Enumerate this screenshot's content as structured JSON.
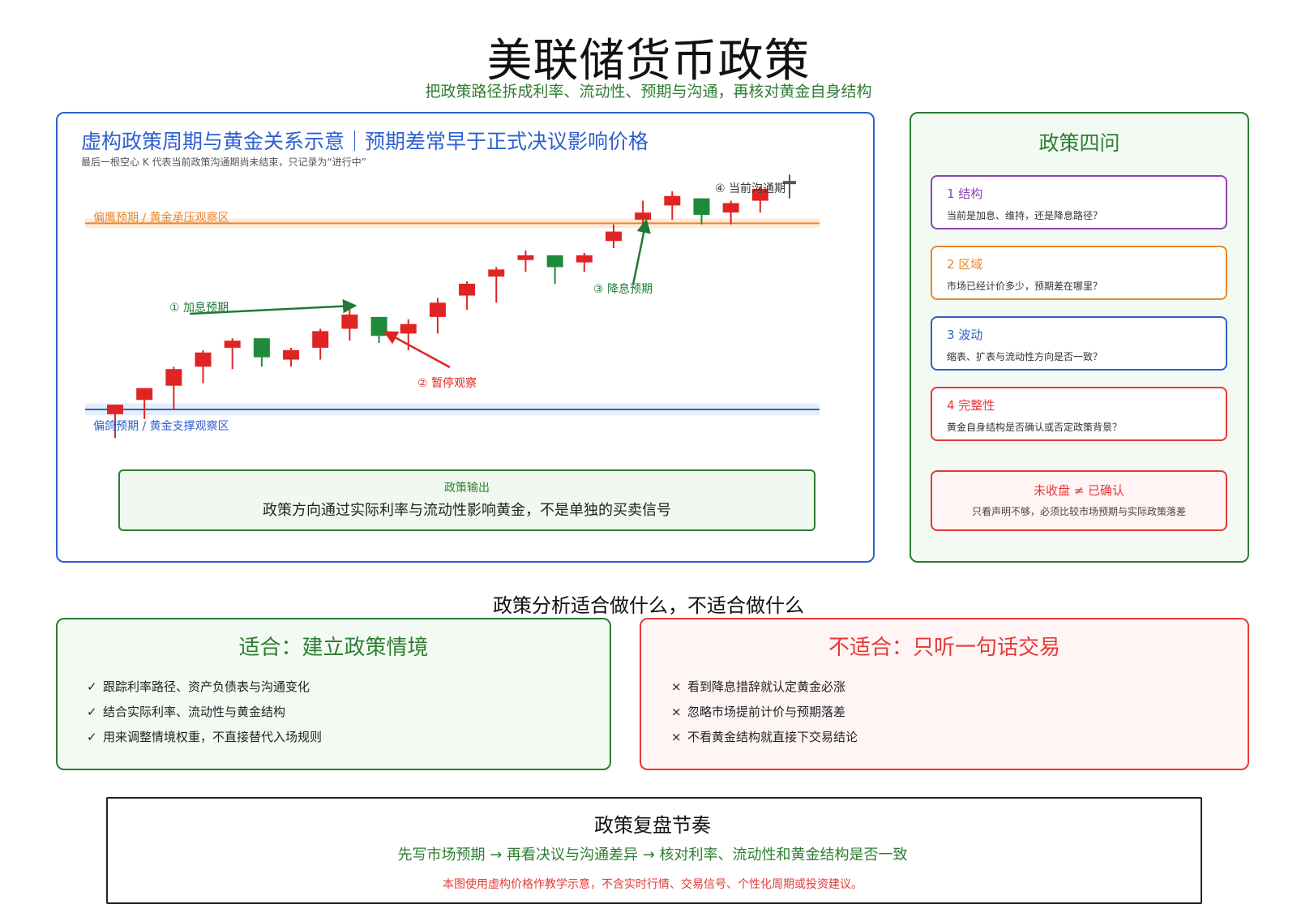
{
  "header": {
    "title": "美联储货币政策",
    "subtitle": "把政策路径拆成利率、流动性、预期与沟通，再核对黄金自身结构"
  },
  "chart_panel": {
    "title": "虚构政策周期与黄金关系示意｜预期差常早于正式决议影响价格",
    "note": "最后一根空心 K 代表当前政策沟通期尚未结束，只记录为“进行中”",
    "upper_zone_label": "偏鹰预期 / 黄金承压观察区",
    "lower_zone_label": "偏鸽预期 / 黄金支撑观察区",
    "annotations": [
      "① 加息预期",
      "② 暂停观察",
      "③ 降息预期",
      "④ 当前沟通期"
    ],
    "output_label": "政策输出",
    "output_text": "政策方向通过实际利率与流动性影响黄金，不是单独的买卖信号"
  },
  "chart_data": {
    "type": "candlestick",
    "note": "fictional illustrative price path",
    "colors": {
      "up": "#e02424",
      "down": "#1e8a3a",
      "open_candle": "#555555",
      "upper_zone": "#e8862d",
      "lower_zone": "#2f5fd0"
    },
    "upper_zone": {
      "center": 86.5,
      "low": 84.5,
      "high": 88.5
    },
    "lower_zone": {
      "center": 8,
      "low": 5.5,
      "high": 10.5
    },
    "ylim": [
      -5,
      102
    ],
    "candles": [
      {
        "o": 6,
        "h": 10,
        "l": -4,
        "c": 10
      },
      {
        "o": 12,
        "h": 17,
        "l": 4,
        "c": 17
      },
      {
        "o": 18,
        "h": 26,
        "l": 8,
        "c": 25
      },
      {
        "o": 26,
        "h": 33,
        "l": 19,
        "c": 32
      },
      {
        "o": 34,
        "h": 38,
        "l": 25,
        "c": 37
      },
      {
        "o": 38,
        "h": 38,
        "l": 26,
        "c": 30
      },
      {
        "o": 29,
        "h": 34,
        "l": 26,
        "c": 33
      },
      {
        "o": 34,
        "h": 42,
        "l": 29,
        "c": 41
      },
      {
        "o": 42,
        "h": 50,
        "l": 37,
        "c": 48
      },
      {
        "o": 47,
        "h": 47,
        "l": 36,
        "c": 39
      },
      {
        "o": 40,
        "h": 46,
        "l": 33,
        "c": 44
      },
      {
        "o": 47,
        "h": 55,
        "l": 40,
        "c": 53
      },
      {
        "o": 56,
        "h": 62,
        "l": 50,
        "c": 61
      },
      {
        "o": 64,
        "h": 68,
        "l": 53,
        "c": 67
      },
      {
        "o": 71,
        "h": 75,
        "l": 66,
        "c": 73
      },
      {
        "o": 73,
        "h": 73,
        "l": 61,
        "c": 68
      },
      {
        "o": 70,
        "h": 74,
        "l": 66,
        "c": 73
      },
      {
        "o": 79,
        "h": 86,
        "l": 76,
        "c": 83
      },
      {
        "o": 88,
        "h": 96,
        "l": 83,
        "c": 91
      },
      {
        "o": 94,
        "h": 100,
        "l": 88,
        "c": 98
      },
      {
        "o": 97,
        "h": 97,
        "l": 86,
        "c": 90
      },
      {
        "o": 91,
        "h": 96,
        "l": 86,
        "c": 95
      },
      {
        "o": 96,
        "h": 102,
        "l": 91,
        "c": 101
      },
      {
        "o": 104,
        "h": 107,
        "l": 97,
        "c": 104,
        "open": true
      }
    ]
  },
  "questions": {
    "title": "政策四问",
    "items": [
      {
        "head": "1 结构",
        "body": "当前是加息、维持，还是降息路径？",
        "color": "#8e44ad"
      },
      {
        "head": "2 区域",
        "body": "市场已经计价多少，预期差在哪里？",
        "color": "#e8862d"
      },
      {
        "head": "3 波动",
        "body": "缩表、扩表与流动性方向是否一致？",
        "color": "#2f5fd0"
      },
      {
        "head": "4 完整性",
        "body": "黄金自身结构是否确认或否定政策背景？",
        "color": "#e53935"
      }
    ],
    "warning_title": "未收盘 ≠ 已确认",
    "warning_text": "只看声明不够，必须比较市场预期与实际政策落差"
  },
  "usage": {
    "section_title": "政策分析适合做什么，不适合做什么",
    "fit_title": "适合：建立政策情境",
    "fit_mark": "✓",
    "fit_items": [
      "跟踪利率路径、资产负债表与沟通变化",
      "结合实际利率、流动性与黄金结构",
      "用来调整情境权重，不直接替代入场规则"
    ],
    "nofit_title": "不适合：只听一句话交易",
    "nofit_mark": "×",
    "nofit_items": [
      "看到降息措辞就认定黄金必涨",
      "忽略市场提前计价与预期落差",
      "不看黄金结构就直接下交易结论"
    ]
  },
  "rhythm": {
    "title": "政策复盘节奏",
    "flow": "先写市场预期 → 再看决议与沟通差异 → 核对利率、流动性和黄金结构是否一致",
    "disclaimer": "本图使用虚构价格作教学示意，不含实时行情、交易信号、个性化周期或投资建议。"
  }
}
